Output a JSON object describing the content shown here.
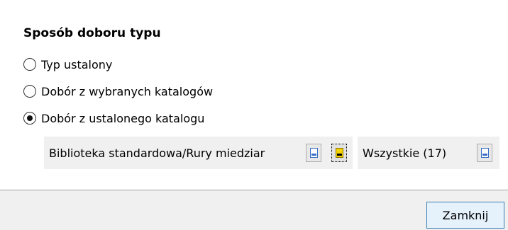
{
  "window": {
    "group_title": "Sposób doboru typu",
    "options": [
      {
        "label": "Typ ustalony",
        "selected": false
      },
      {
        "label": "Dobór z wybranych katalogów",
        "selected": false
      },
      {
        "label": "Dobór z ustalonego katalogu",
        "selected": true
      }
    ],
    "catalog": {
      "path_value": "Biblioteka standardowa/Rury miedziar",
      "filter_value": "Wszystkie (17)",
      "icons": {
        "open_catalog": "document-blue-icon",
        "select_catalog": "document-yellow-icon",
        "open_filter": "document-blue-icon"
      }
    },
    "footer": {
      "close_label": "Zamknij"
    },
    "colors": {
      "panel_background": "#ffffff",
      "footer_background": "#f0f0f0",
      "field_background": "#f0f0f0",
      "button_border_accent": "#3c7fb1",
      "button_background": "#e5f1fb"
    }
  }
}
